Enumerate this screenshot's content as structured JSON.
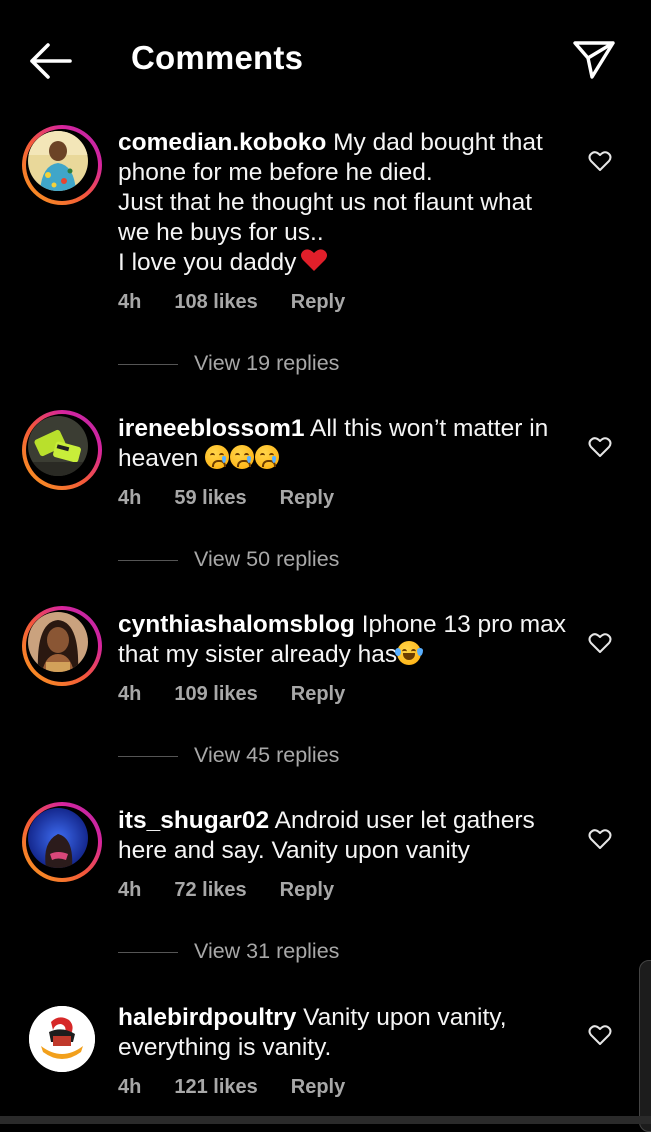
{
  "header": {
    "title": "Comments",
    "back_icon": "arrow-left-icon",
    "send_icon": "paper-plane-icon"
  },
  "comments": [
    {
      "username": "comedian.koboko",
      "lines": [
        "My dad bought that",
        "phone for me before he died.",
        "Just that he thought us not flaunt what",
        "we he buys for us..",
        "I love you daddy"
      ],
      "emoji": "red-heart",
      "time": "4h",
      "likes": "108 likes",
      "reply": "Reply",
      "view_replies": "View 19 replies"
    },
    {
      "username": "ireneeblossom1",
      "lines": [
        "All this won’t matter in",
        "heaven"
      ],
      "emoji": "crying-face x3",
      "time": "4h",
      "likes": "59 likes",
      "reply": "Reply",
      "view_replies": "View 50 replies"
    },
    {
      "username": "cynthiashalomsblog",
      "lines": [
        "Iphone 13 pro max",
        "that my sister already has"
      ],
      "emoji": "tears-of-joy",
      "time": "4h",
      "likes": "109 likes",
      "reply": "Reply",
      "view_replies": "View 45 replies"
    },
    {
      "username": "its_shugar02",
      "lines": [
        "Android user let gathers",
        "here and say.  Vanity upon vanity"
      ],
      "time": "4h",
      "likes": "72 likes",
      "reply": "Reply",
      "view_replies": "View 31 replies"
    },
    {
      "username": "halebirdpoultry",
      "lines": [
        "Vanity upon vanity,",
        "everything is vanity."
      ],
      "time": "4h",
      "likes": "121 likes",
      "reply": "Reply"
    }
  ],
  "colors": {
    "background": "#000000",
    "text": "#ffffff",
    "meta": "#a8a8a8",
    "story_ring_start": "#f9a11b",
    "story_ring_end": "#b02aa6"
  }
}
